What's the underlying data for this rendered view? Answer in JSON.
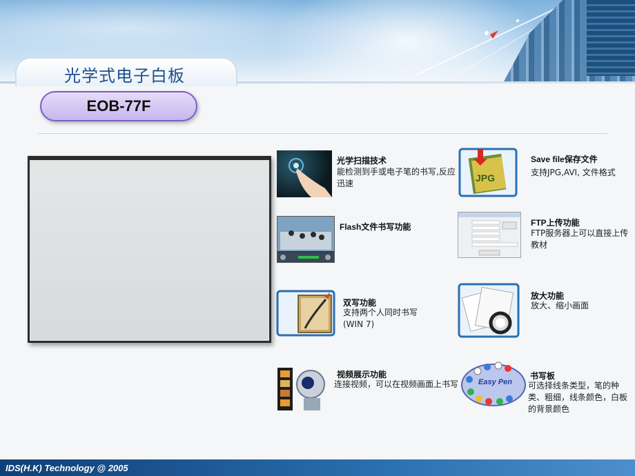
{
  "slide": {
    "title": "光学式电子白板",
    "model": "EOB-77F",
    "footer": "IDS(H.K) Technology @ 2005"
  },
  "features": [
    {
      "icon": "touch-scan-icon",
      "title": "光学扫描技术",
      "desc": "能检测到手或电子笔的书写,反应迅速"
    },
    {
      "icon": "jpg-file-icon",
      "title": "Save file保存文件",
      "desc": "支持JPG,AVI, 文件格式"
    },
    {
      "icon": "classroom-video-icon",
      "title": "Flash文件书写功能",
      "desc": ""
    },
    {
      "icon": "ftp-dialog-icon",
      "title": "FTP上传功能",
      "desc": " FTP服务器上可以直接上传教材"
    },
    {
      "icon": "dual-write-pen-icon",
      "title": "双写功能",
      "desc": "支持两个人同时书写\n(WIN 7)"
    },
    {
      "icon": "magnifier-icon",
      "title": "放大功能",
      "desc": "放大、缩小画面"
    },
    {
      "icon": "video-camera-icon",
      "title": "视频展示功能",
      "desc": " 连接视频，可以在视频画面上书写"
    },
    {
      "icon": "easy-pen-palette-icon",
      "title": "书写板",
      "desc": "可选择线条类型，笔的种类、粗细，线条颜色，白板的背景颜色"
    }
  ],
  "icons": {
    "easy_pen_label": "Easy Pen",
    "jpg_label": "JPG"
  }
}
